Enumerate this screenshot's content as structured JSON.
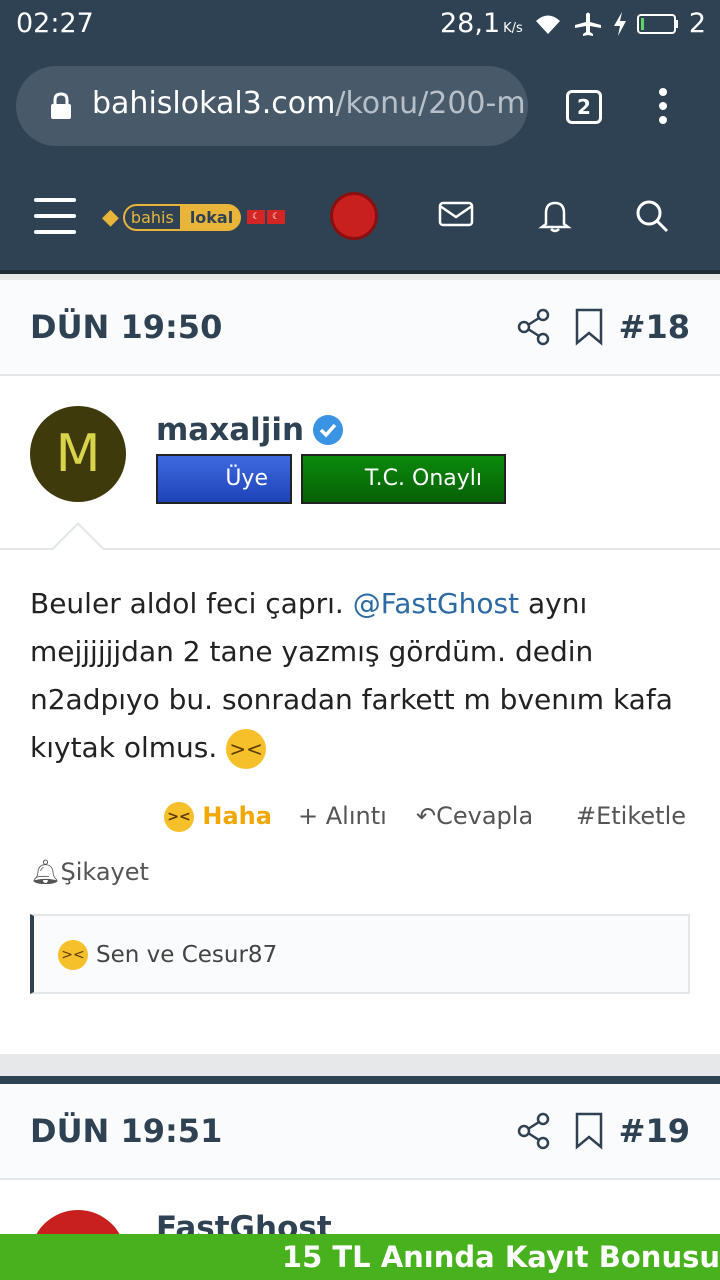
{
  "status_bar": {
    "time": "02:27",
    "speed": "28,1",
    "speed_unit": "K/s",
    "battery_text": "2"
  },
  "browser": {
    "url_host": "bahislokal3.com",
    "url_path": "/konu/200-m",
    "tab_count": "2"
  },
  "nav": {
    "logo_bahis": "bahis",
    "logo_lokal": "lokal",
    "icons": [
      "hamburger-icon",
      "mail-icon",
      "bell-icon",
      "search-icon"
    ]
  },
  "posts": [
    {
      "date": "DÜN 19:50",
      "number": "#18",
      "author": "maxaljin",
      "avatar_letter": "M",
      "badge_member": "Üye",
      "badge_verified": "T.C. Onaylı",
      "body_start": "Beuler aldol feci çaprı. ",
      "mention": "@FastGhost",
      "body_end": " aynı mejjjjjjdan 2 tane yazmış gördüm. dedin n2adpıyo bu. sonradan farkett m bvenım kafa kıytak olmus. ",
      "reaction_label": "Haha",
      "quote_label": "+ Alıntı",
      "reply_label": "Cevapla",
      "tag_label": "#Etiketle",
      "report_label": "Şikayet",
      "reactions_text": "Sen ve Cesur87"
    },
    {
      "date": "DÜN 19:51",
      "number": "#19",
      "author": "FastGhost"
    }
  ],
  "ad": {
    "text": "15 TL Anında Kayıt Bonusu"
  },
  "colors": {
    "header_bg": "#2f4254",
    "accent_yellow": "#e8b53a",
    "ad_green": "#47b21e",
    "mention_blue": "#2d6aa3"
  }
}
